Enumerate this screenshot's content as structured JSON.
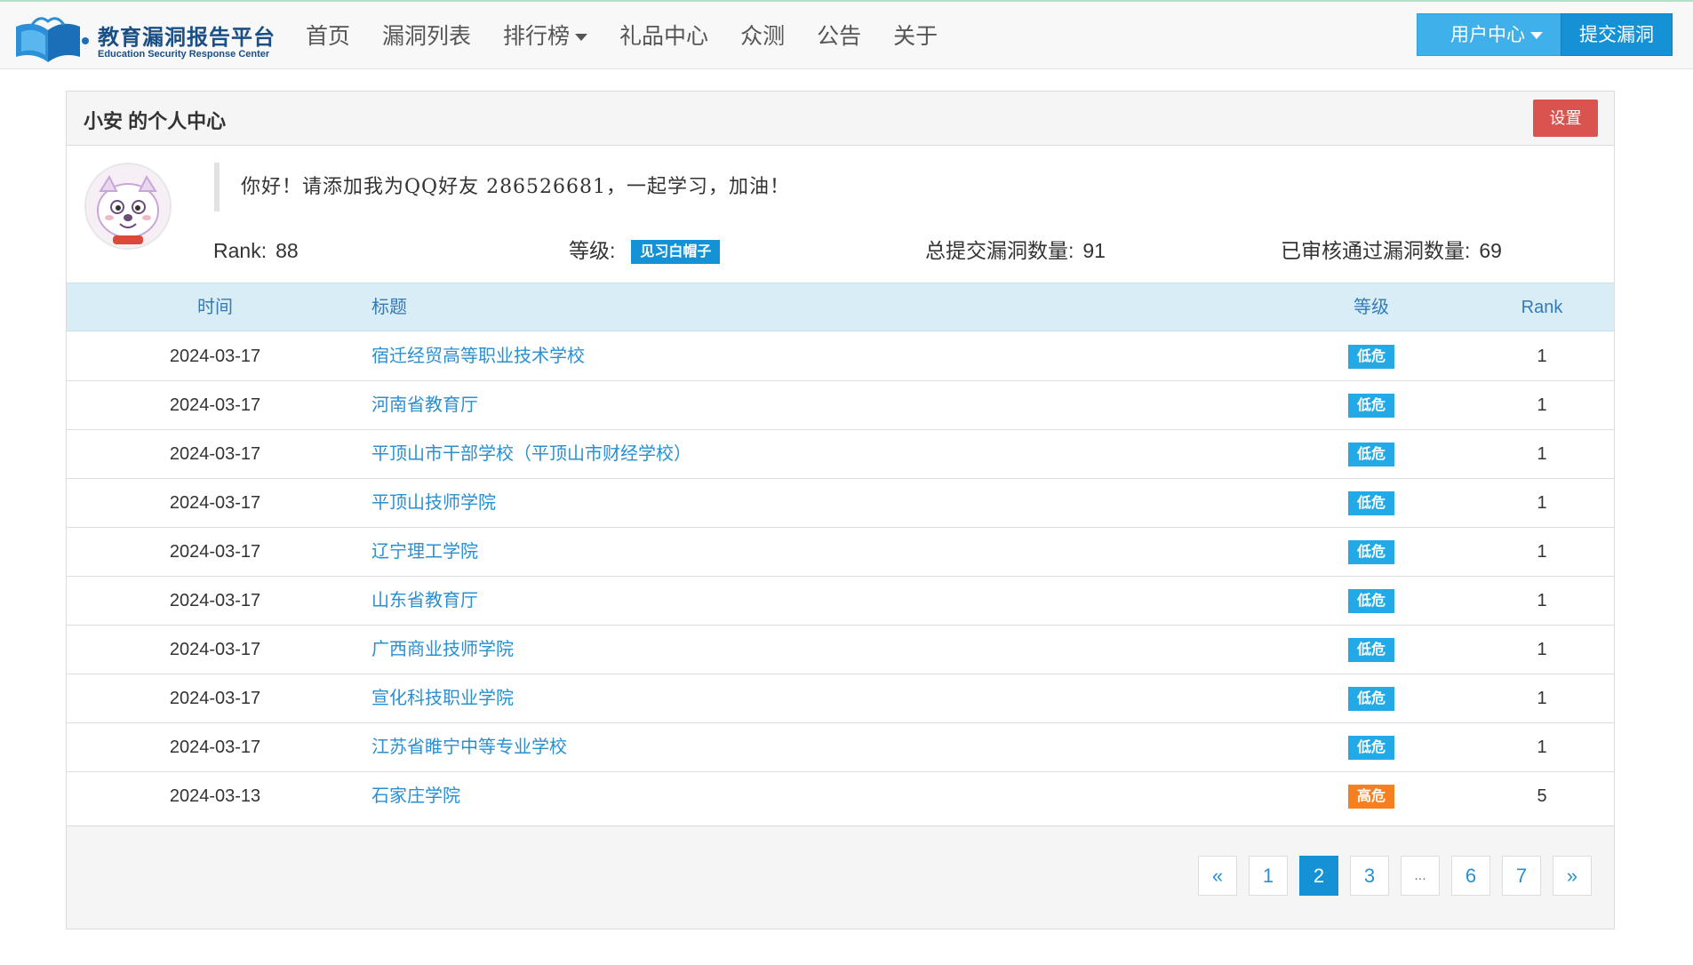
{
  "brand": {
    "title": "教育漏洞报告平台",
    "subtitle": "Education Security Response Center"
  },
  "nav": {
    "home": "首页",
    "vuln_list": "漏洞列表",
    "ranking": "排行榜",
    "gifts": "礼品中心",
    "crowdtest": "众测",
    "notice": "公告",
    "about": "关于",
    "user_center": "用户中心",
    "submit": "提交漏洞"
  },
  "profile": {
    "title": "小安 的个人中心",
    "settings_label": "设置",
    "quote": "你好！请添加我为QQ好友 286526681，一起学习，加油！",
    "rank_label": "Rank:",
    "rank_value": "88",
    "level_label": "等级:",
    "level_badge": "见习白帽子",
    "total_label": "总提交漏洞数量:",
    "total_value": "91",
    "approved_label": "已审核通过漏洞数量:",
    "approved_value": "69"
  },
  "table": {
    "headers": {
      "time": "时间",
      "title": "标题",
      "level": "等级",
      "rank": "Rank"
    },
    "rows": [
      {
        "date": "2024-03-17",
        "title": "宿迁经贸高等职业技术学校",
        "level": "低危",
        "rank": "1"
      },
      {
        "date": "2024-03-17",
        "title": "河南省教育厅",
        "level": "低危",
        "rank": "1"
      },
      {
        "date": "2024-03-17",
        "title": "平顶山市干部学校（平顶山市财经学校）",
        "level": "低危",
        "rank": "1"
      },
      {
        "date": "2024-03-17",
        "title": "平顶山技师学院",
        "level": "低危",
        "rank": "1"
      },
      {
        "date": "2024-03-17",
        "title": "辽宁理工学院",
        "level": "低危",
        "rank": "1"
      },
      {
        "date": "2024-03-17",
        "title": "山东省教育厅",
        "level": "低危",
        "rank": "1"
      },
      {
        "date": "2024-03-17",
        "title": "广西商业技师学院",
        "level": "低危",
        "rank": "1"
      },
      {
        "date": "2024-03-17",
        "title": "宣化科技职业学院",
        "level": "低危",
        "rank": "1"
      },
      {
        "date": "2024-03-17",
        "title": "江苏省睢宁中等专业学校",
        "level": "低危",
        "rank": "1"
      },
      {
        "date": "2024-03-13",
        "title": "石家庄学院",
        "level": "高危",
        "rank": "5"
      }
    ]
  },
  "pagination": {
    "prev": "«",
    "pages": [
      "1",
      "2",
      "3",
      "...",
      "6",
      "7"
    ],
    "current": "2",
    "next": "»"
  },
  "colors": {
    "primary": "#1592d6",
    "user_button": "#3fb0ea",
    "danger": "#d9534f",
    "severity_low": "#23a9e6",
    "severity_high": "#f6801f",
    "link": "#2a8fd0",
    "table_header_bg": "#d9edf7"
  }
}
